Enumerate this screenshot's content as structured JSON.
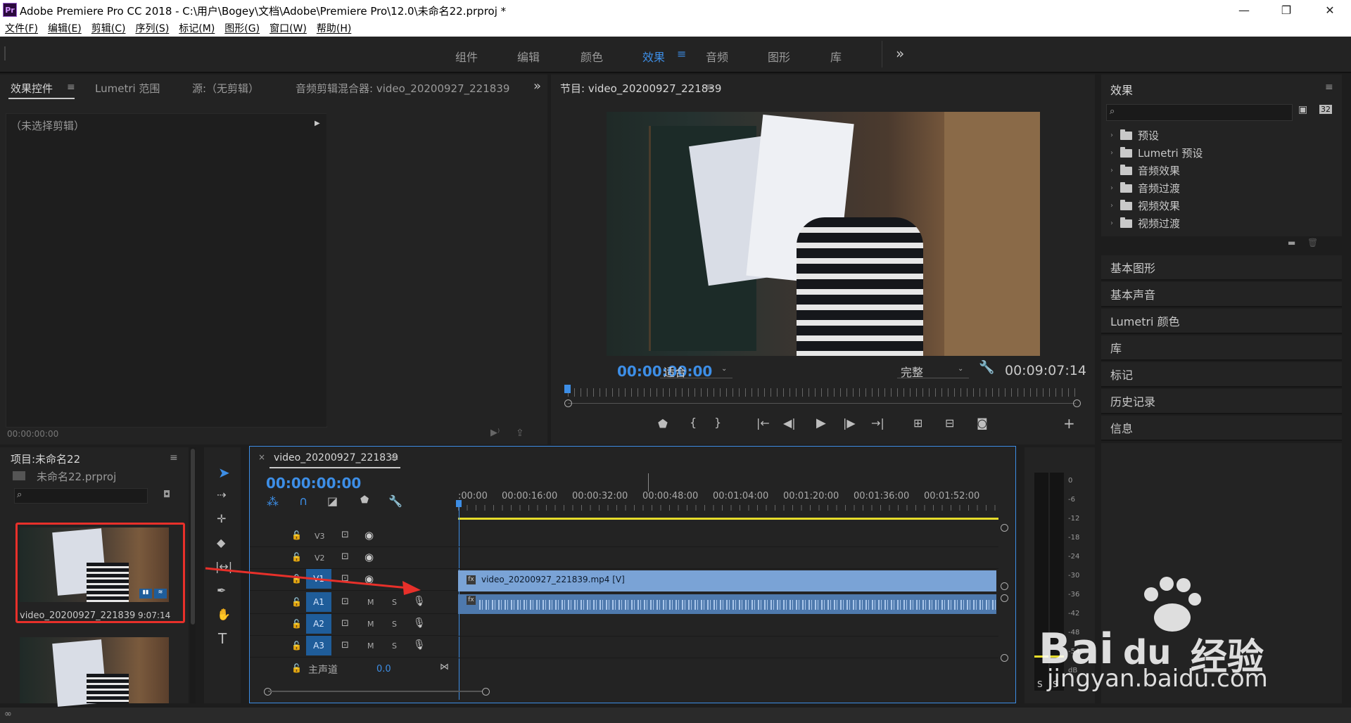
{
  "window": {
    "title": "Adobe Premiere Pro CC 2018 - C:\\用户\\Bogey\\文档\\Adobe\\Premiere Pro\\12.0\\未命名22.prproj *",
    "app_icon_label": "Pr",
    "minimize": "—",
    "restore": "❐",
    "close": "✕"
  },
  "menu": [
    "文件(F)",
    "编辑(E)",
    "剪辑(C)",
    "序列(S)",
    "标记(M)",
    "图形(G)",
    "窗口(W)",
    "帮助(H)"
  ],
  "workspaces": {
    "items": [
      "组件",
      "编辑",
      "颜色",
      "效果",
      "音频",
      "图形",
      "库"
    ],
    "active": "效果",
    "more": "»"
  },
  "effect_controls": {
    "tabs": [
      "效果控件",
      "Lumetri 范围",
      "源:（无剪辑）",
      "音频剪辑混合器: video_20200927_221839"
    ],
    "no_clip": "（未选择剪辑）",
    "timecode": "00:00:00:00",
    "more": "»"
  },
  "program_monitor": {
    "title": "节目: video_20200927_221839",
    "timecode": "00:00:00:00",
    "fit": "适合",
    "quality": "完整",
    "duration": "00:09:07:14"
  },
  "effects_panel": {
    "title": "效果",
    "search_placeholder": "",
    "folders": [
      "预设",
      "Lumetri 预设",
      "音频效果",
      "音频过渡",
      "视频效果",
      "视频过渡"
    ],
    "sections": [
      "基本图形",
      "基本声音",
      "Lumetri 颜色",
      "库",
      "标记",
      "历史记录",
      "信息"
    ]
  },
  "project": {
    "title": "项目:未命名22",
    "file": "未命名22.prproj",
    "clip_name": "video_20200927_221839",
    "clip_duration": "9:07:14"
  },
  "timeline": {
    "tab": "video_20200927_221839",
    "timecode": "00:00:00:00",
    "ruler": [
      ":00:00",
      "00:00:16:00",
      "00:00:32:00",
      "00:00:48:00",
      "00:01:04:00",
      "00:01:20:00",
      "00:01:36:00",
      "00:01:52:00"
    ],
    "video_tracks": [
      "V3",
      "V2",
      "V1"
    ],
    "audio_tracks": [
      "A1",
      "A2",
      "A3"
    ],
    "master": "主声道",
    "master_value": "0.0",
    "video_clip": "video_20200927_221839.mp4 [V]",
    "m": "M",
    "s": "S"
  },
  "meter": {
    "scale": [
      "0",
      "-6",
      "-12",
      "-18",
      "-24",
      "-30",
      "-36",
      "-42",
      "-48",
      "-54",
      "dB"
    ],
    "s_left": "S",
    "s_right": "S"
  },
  "watermark": {
    "brand": "Bai",
    "brand2": "du",
    "cn": "经验",
    "url": "jingyan.baidu.com"
  },
  "colors": {
    "accent": "#3d8ee6",
    "panel": "#232323",
    "clip": "#7aa3d6",
    "annotation": "#e8302a"
  }
}
